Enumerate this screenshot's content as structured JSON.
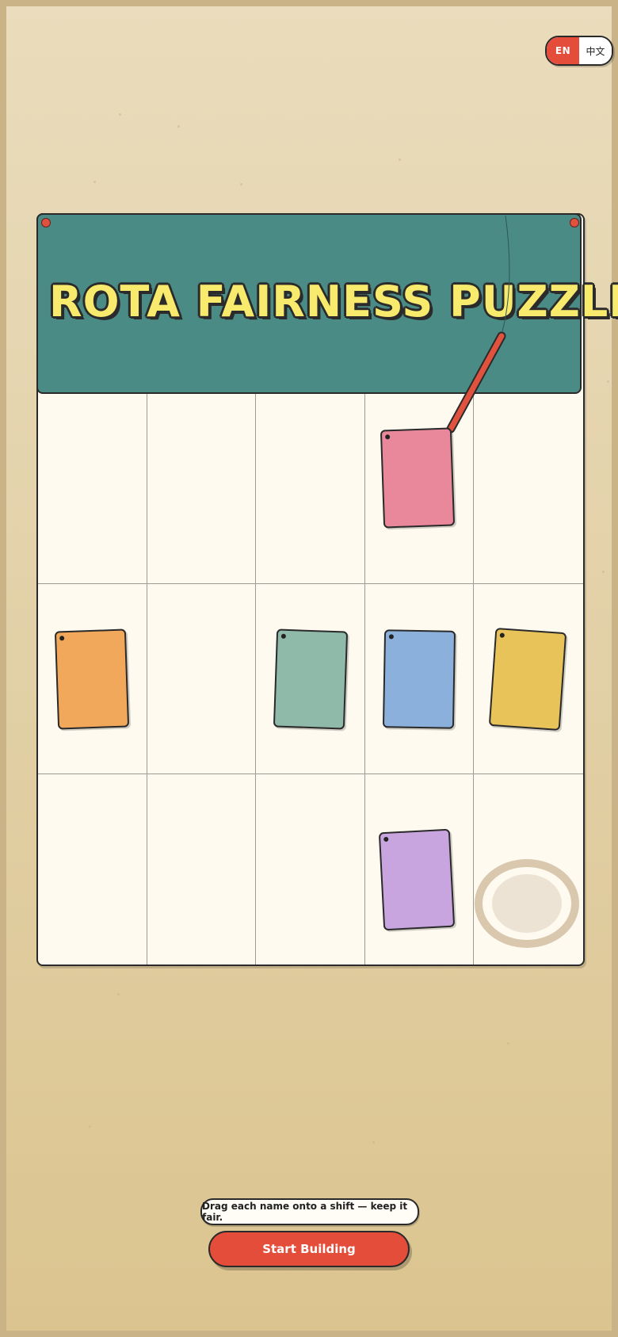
{
  "language_toggle": {
    "en_label": "EN",
    "zh_label": "中文",
    "active": "EN"
  },
  "banner": {
    "title": "ROTA FAIRNESS PUZZLE",
    "background_color": "#4b8b86",
    "title_color": "#f7ea6c"
  },
  "board": {
    "columns": 5,
    "rows": 3
  },
  "name_cards": [
    {
      "color": "#e8889a",
      "column": 4,
      "row": 1
    },
    {
      "color": "#f2a85a",
      "column": 1,
      "row": 2
    },
    {
      "color": "#8fb9a8",
      "column": 3,
      "row": 2
    },
    {
      "color": "#8bb0dc",
      "column": 4,
      "row": 2
    },
    {
      "color": "#e8c35a",
      "column": 5,
      "row": 2
    },
    {
      "color": "#c9a5e0",
      "column": 4,
      "row": 3
    }
  ],
  "hint_text": "Drag each name onto a shift — keep it fair.",
  "start_button_label": "Start Building",
  "accent_color": "#e44d3a"
}
